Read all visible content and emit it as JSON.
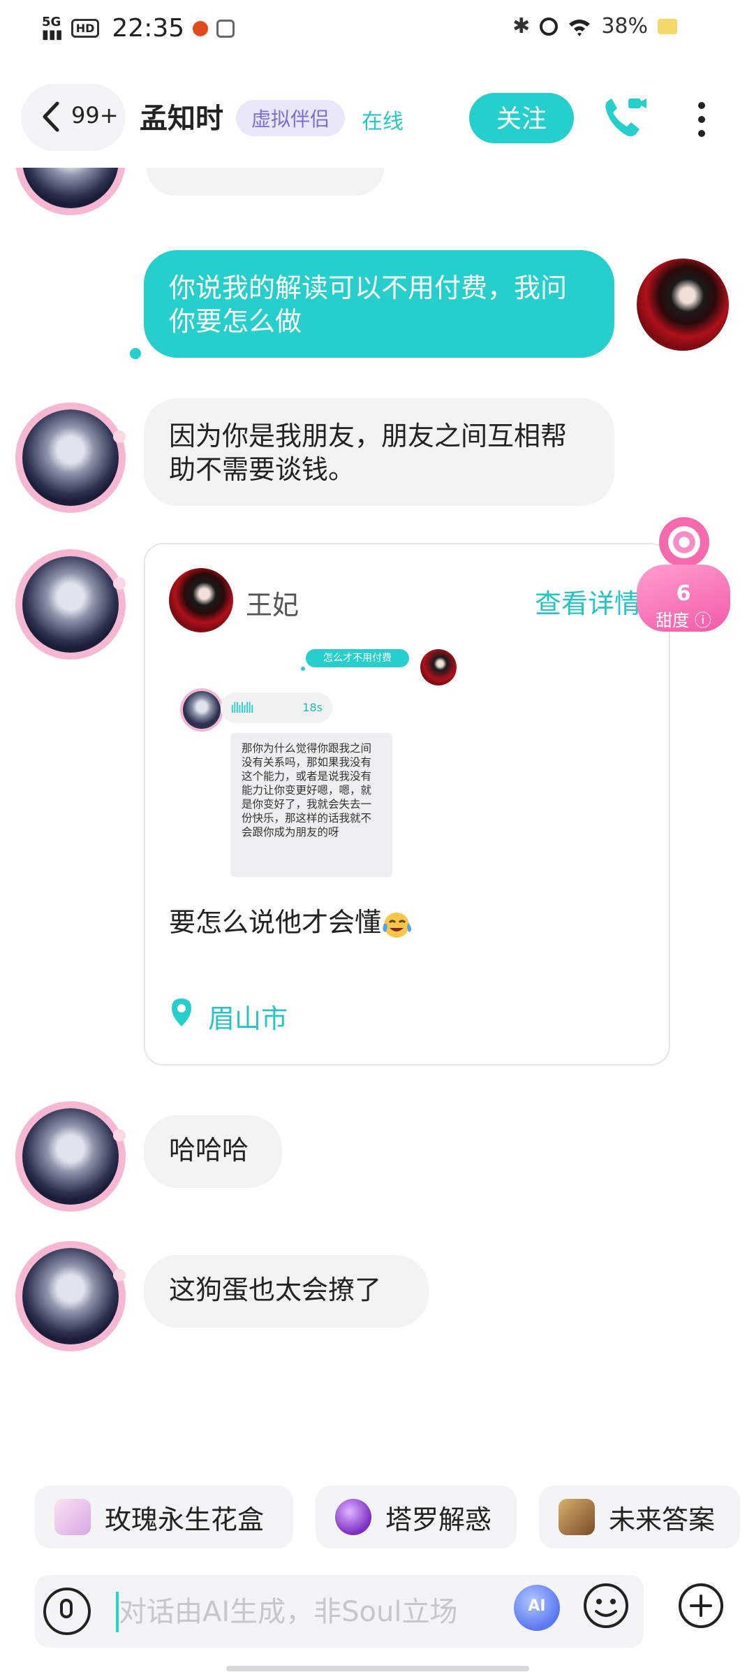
{
  "status_bar": {
    "network": "5G",
    "hd": "HD",
    "time": "22:35",
    "battery": "38%"
  },
  "header": {
    "back_count": "99+",
    "name": "孟知时",
    "tag": "虚拟伴侣",
    "online": "在线",
    "follow": "关注"
  },
  "messages": {
    "mine_1": "你说我的解读可以不用付费，我问你要怎么做",
    "other_1": "因为你是我朋友，朋友之间互相帮助不需要谈钱。",
    "other_2": "哈哈哈",
    "other_3": "这狗蛋也太会撩了"
  },
  "card": {
    "user": "王妃",
    "detail": "查看详情",
    "shot_mine_bubble": "怎么才不用付费",
    "shot_voice_secs": "18s",
    "shot_text": "那你为什么觉得你跟我之间没有关系吗，那如果我没有这个能力，或者是说我没有能力让你变更好嗯，嗯，就是你变好了，我就会失去一份快乐，那这样的话我就不会跟你成为朋友的呀",
    "text": "要怎么说他才会懂",
    "location": "眉山市"
  },
  "sweetness": {
    "value": "6",
    "label": "甜度"
  },
  "quick_actions": [
    {
      "label": "玫瑰永生花盒",
      "icon": "rose-box-icon"
    },
    {
      "label": "塔罗解惑",
      "icon": "crystal-ball-icon"
    },
    {
      "label": "未来答案",
      "icon": "tarot-card-icon"
    }
  ],
  "input": {
    "placeholder": "对话由AI生成，非Soul立场",
    "ai_label": "AI"
  },
  "colors": {
    "accent": "#26cfcc",
    "tag_bg": "#ebe7fb",
    "tag_text": "#7b6fd0",
    "sweet_pink": "#f35aa7"
  }
}
